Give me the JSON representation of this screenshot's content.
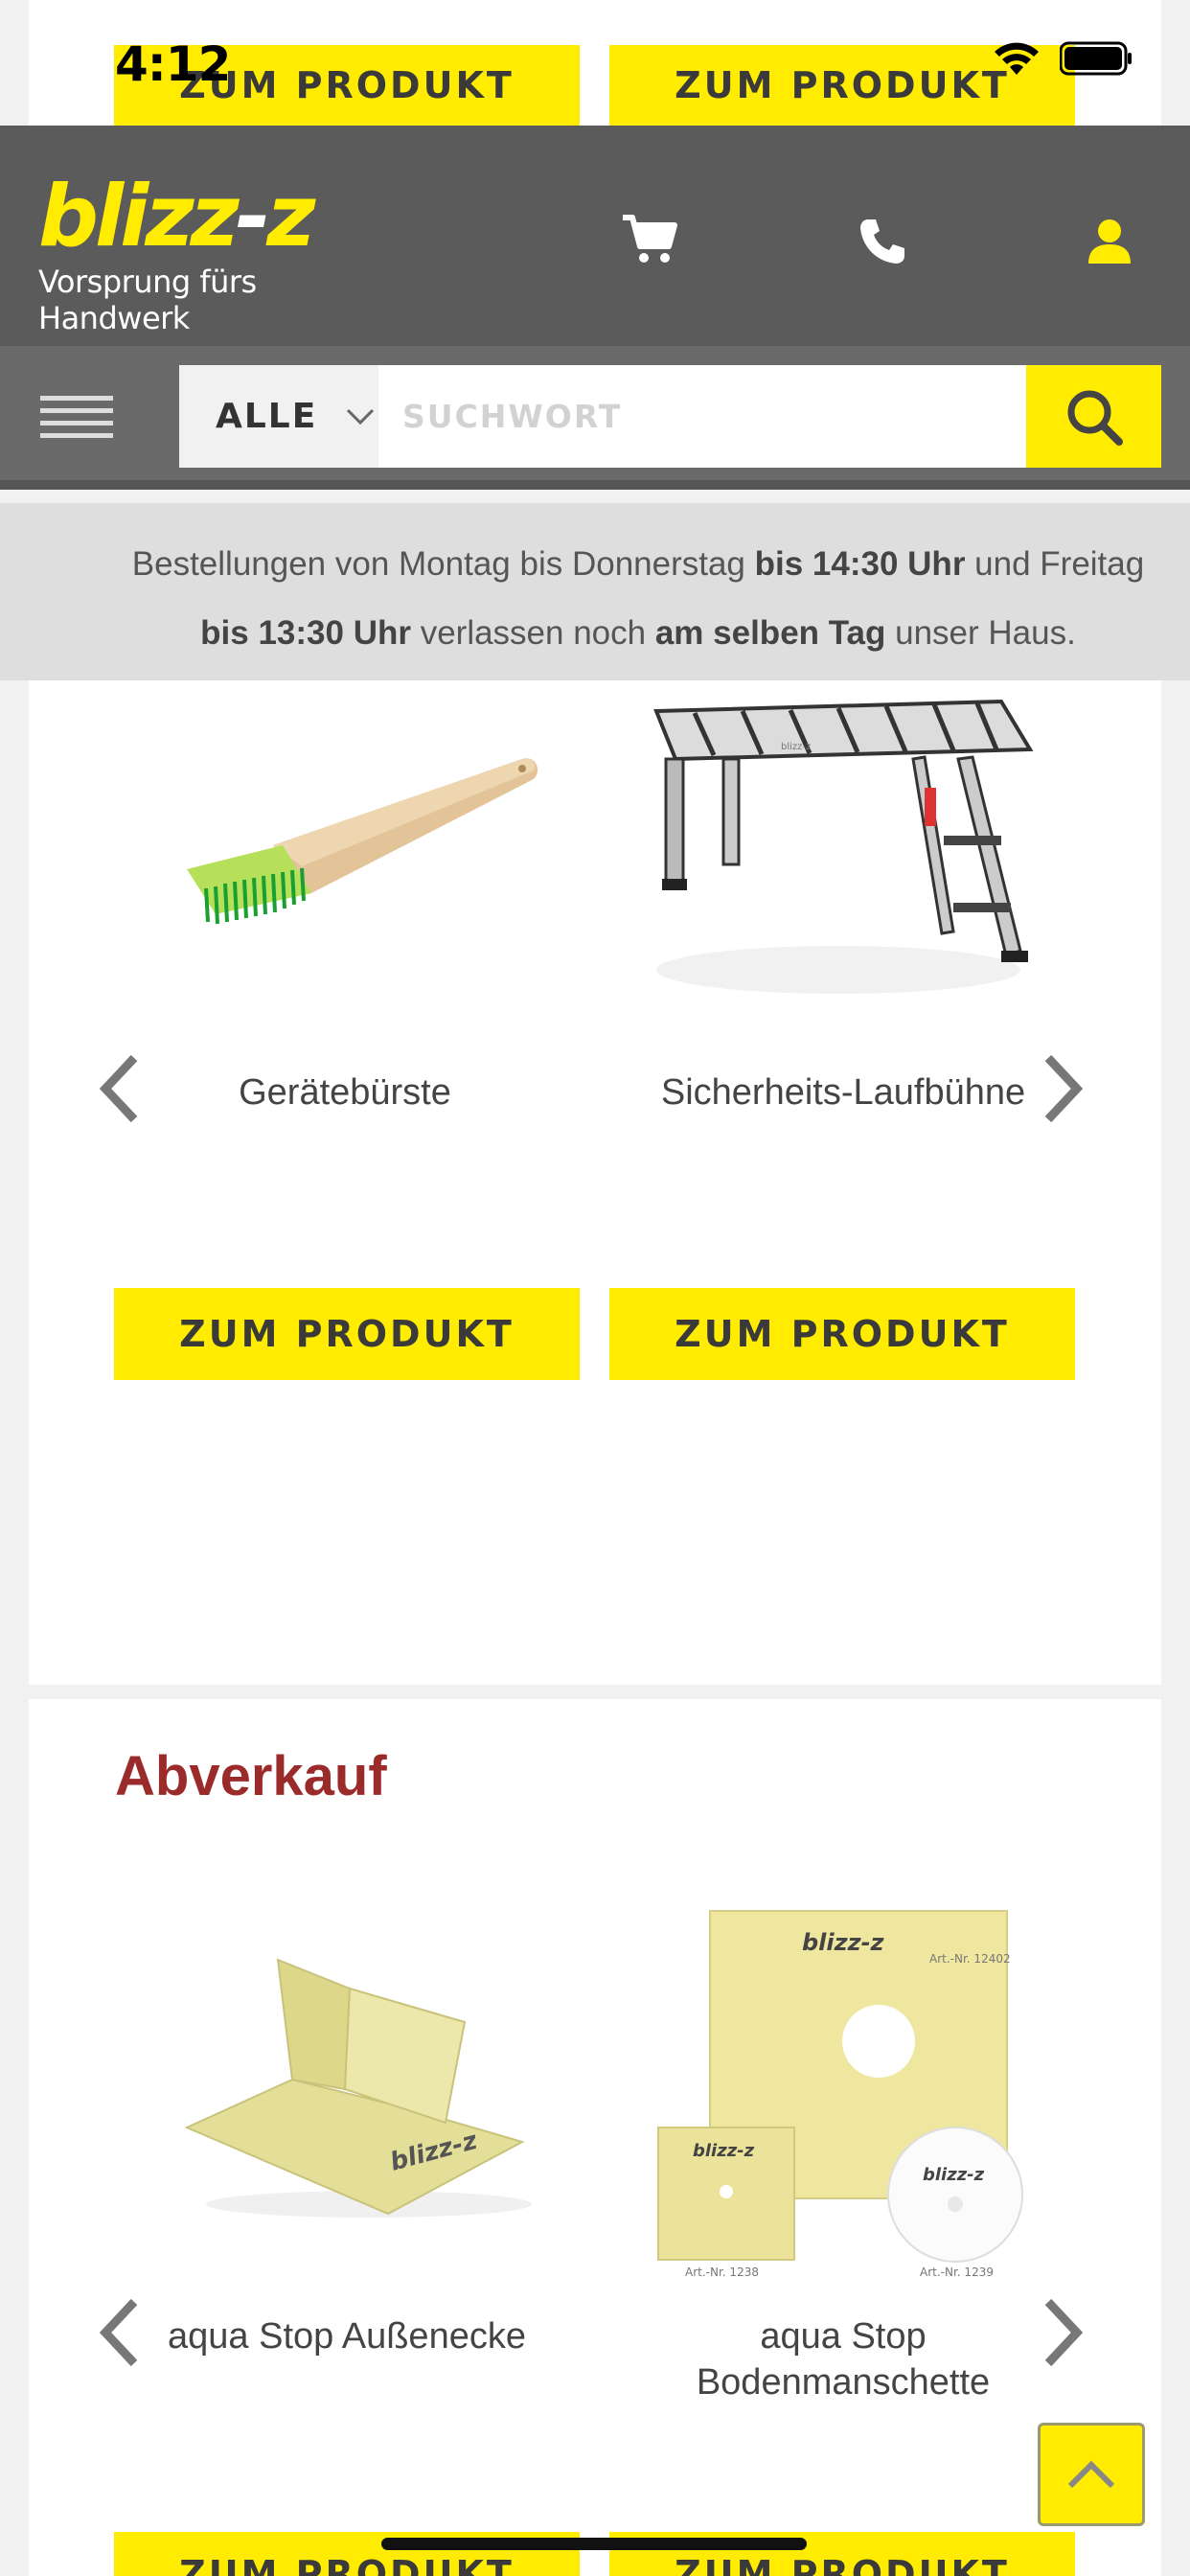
{
  "status": {
    "time": "4:12"
  },
  "top_buttons": [
    "ZUM PRODUKT",
    "ZUM PRODUKT"
  ],
  "header": {
    "logo_main": "blizz",
    "logo_z": "z",
    "tagline": "Vorsprung fürs Handwerk"
  },
  "search": {
    "category": "ALLE",
    "placeholder": "SUCHWORT"
  },
  "notice": {
    "p1": "Bestellungen von Montag bis Donnerstag ",
    "b1": "bis 14:30 Uhr",
    "p2": " und Freitag ",
    "b2": "bis 13:30 Uhr",
    "p3": " verlassen noch ",
    "b3": "am selben Tag",
    "p4": " unser Haus."
  },
  "carousel1": {
    "items": [
      {
        "name": "Gerätebürste",
        "button": "ZUM PRODUKT"
      },
      {
        "name": "Sicherheits-Laufbühne",
        "button": "ZUM PRODUKT"
      }
    ]
  },
  "abverkauf": {
    "title": "Abverkauf",
    "items": [
      {
        "name": "aqua Stop Außenecke",
        "button": "ZUM PRODUKT"
      },
      {
        "name": "aqua Stop Bodenmanschette",
        "button": "ZUM PRODUKT"
      }
    ],
    "image_texts": {
      "brand": "blizz-z",
      "art1": "Art.-Nr. 12402",
      "art2": "Art.-Nr. 1238",
      "art3": "Art.-Nr. 1239"
    }
  },
  "colors": {
    "brand_yellow": "#ffec00",
    "header_gray": "#5b5b5b",
    "section_red": "#9b2a2a"
  }
}
